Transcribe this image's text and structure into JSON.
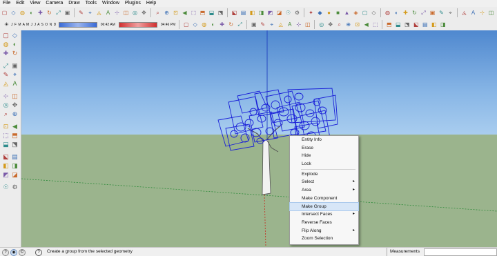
{
  "menu": [
    "File",
    "Edit",
    "View",
    "Camera",
    "Draw",
    "Tools",
    "Window",
    "Plugins",
    "Help"
  ],
  "toolbar_row1_icons": [
    "select-icon",
    "eraser-icon",
    "paint-icon",
    "push-pull-icon",
    "move-icon",
    "rotate-icon",
    "scale-icon",
    "offset-icon",
    "tape-icon",
    "dimension-icon",
    "protractor-icon",
    "text-icon",
    "axes-icon",
    "3d-text-icon",
    "section-icon",
    "orbit-icon",
    "pan-icon",
    "zoom-icon",
    "zoom-window-icon",
    "zoom-extents-icon",
    "previous-icon",
    "iso-icon",
    "top-icon",
    "front-icon",
    "right-icon",
    "back-icon",
    "left-icon",
    "bottom-icon",
    "xray-icon",
    "wireframe-icon",
    "hidden-line-icon",
    "shaded-icon",
    "textured-icon",
    "monochrome-icon",
    "walk-icon",
    "look-icon",
    "position-camera-icon",
    "get-models-icon",
    "share-model-icon",
    "component-icon",
    "model-info-icon",
    "layers-icon",
    "outliner-icon",
    "styles-icon",
    "fog-icon",
    "match-photo-icon",
    "soften-icon",
    "shadows-icon",
    "scenes-icon",
    "warehouse-icon",
    "extension-icon",
    "geo-icon",
    "photo-textures-icon",
    "toggle-terrain-icon",
    "preview-icon",
    "sandbox-icon"
  ],
  "toolbar_row2_icons": [
    "component-make-icon",
    "group-icon",
    "solid-union-icon",
    "solid-subtract-icon",
    "solid-trim-icon",
    "solid-intersect-icon",
    "solid-split-icon",
    "outer-shell-icon",
    "sandbox-contours-icon",
    "sandbox-scratch-icon",
    "smoove-icon",
    "stamp-icon",
    "drape-icon",
    "add-detail-icon",
    "flip-edge-icon",
    "layer-icon",
    "layer-add-icon",
    "layer-remove-icon",
    "dynamic-component-icon",
    "interact-icon",
    "options-icon",
    "attributes-icon",
    "ruby-console-icon",
    "plugin-a-icon",
    "plugin-b-icon",
    "plugin-c-icon",
    "plugin-d-icon",
    "plugin-e-icon"
  ],
  "shadow_settings": {
    "months": "J F M A M J J A S O N D",
    "time_start": "06:42 AM",
    "time_end": "04:46 PM"
  },
  "left_toolbar_icons": [
    "select-icon",
    "component-icon",
    "paint-icon",
    "eraser-icon",
    "rectangle-icon",
    "line-icon",
    "circle-icon",
    "arc-icon",
    "polygon-icon",
    "freehand-icon",
    "move-icon",
    "push-pull-icon",
    "rotate-icon",
    "follow-me-icon",
    "scale-icon",
    "offset-icon",
    "tape-icon",
    "dimension-icon",
    "protractor-icon",
    "text-icon",
    "axes-icon",
    "3d-text-icon",
    "orbit-icon",
    "pan-icon",
    "zoom-icon",
    "zoom-window-icon",
    "zoom-extents-icon",
    "previous-icon",
    "position-camera-icon",
    "walk-icon",
    "look-icon",
    "section-icon"
  ],
  "context_menu": {
    "items": [
      {
        "label": "Entity Info",
        "submenu": false
      },
      {
        "label": "Erase",
        "submenu": false
      },
      {
        "label": "Hide",
        "submenu": false
      },
      {
        "label": "Lock",
        "submenu": false
      },
      {
        "sep": true
      },
      {
        "label": "Explode",
        "submenu": false
      },
      {
        "label": "Select",
        "submenu": true
      },
      {
        "label": "Area",
        "submenu": true
      },
      {
        "label": "Make Component",
        "submenu": false
      },
      {
        "label": "Make Group",
        "submenu": false,
        "highlighted": true
      },
      {
        "label": "Intersect Faces",
        "submenu": true
      },
      {
        "label": "Reverse Faces",
        "submenu": false
      },
      {
        "label": "Flip Along",
        "submenu": true
      },
      {
        "label": "Zoom Selection",
        "submenu": false
      }
    ],
    "submenu_arrow": "▸"
  },
  "status": {
    "text": "Create a group from the selected geometry",
    "measurements_label": "Measurements",
    "measurements_value": ""
  },
  "colors": {
    "sky_top": "#4f88cf",
    "ground": "#9bb48d",
    "selection_blue": "#1a1fd8",
    "axis_red": "#c0392b",
    "axis_green": "#2e8b3a",
    "axis_blue": "#1f3fbf",
    "menu_highlight": "#d7e6f7"
  }
}
